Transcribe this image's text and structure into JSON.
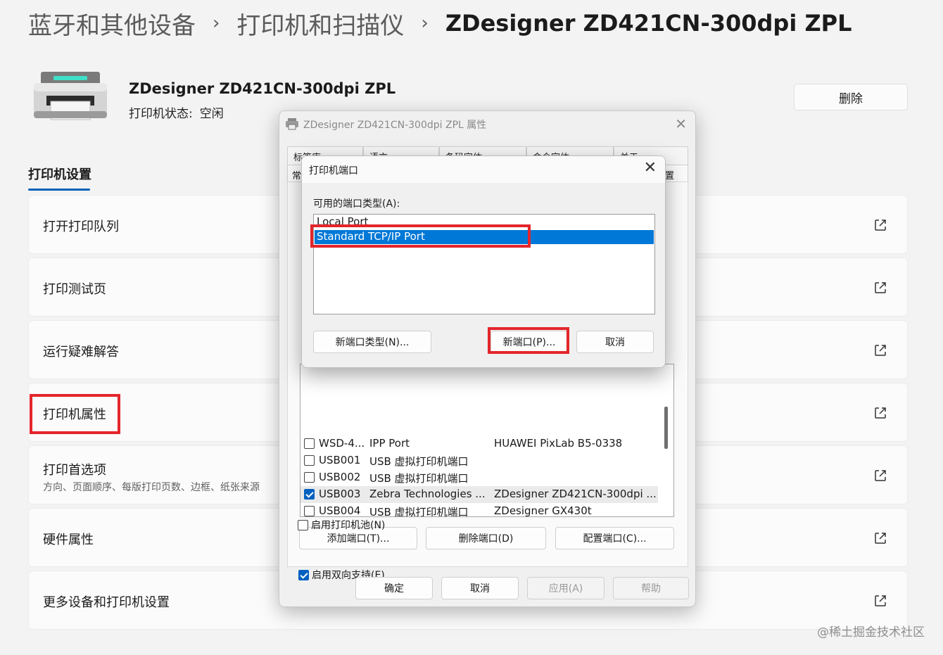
{
  "breadcrumb": {
    "item1": "蓝牙和其他设备",
    "item2": "打印机和扫描仪",
    "current": "ZDesigner ZD421CN-300dpi ZPL",
    "sep": "›"
  },
  "header": {
    "printer_name": "ZDesigner ZD421CN-300dpi ZPL",
    "status_label": "打印机状态:",
    "status_value": "空闲",
    "delete_label": "删除"
  },
  "section_tab": "打印机设置",
  "cards": [
    {
      "label": "打开打印队列"
    },
    {
      "label": "打印测试页"
    },
    {
      "label": "运行疑难解答"
    },
    {
      "label": "打印机属性"
    },
    {
      "label": "打印首选项",
      "sub": "方向、页面顺序、每版打印页数、边框、纸张来源"
    },
    {
      "label": "硬件属性"
    },
    {
      "label": "更多设备和打印机设置"
    }
  ],
  "props_dialog": {
    "title": "ZDesigner ZD421CN-300dpi ZPL 属性",
    "tabs_row1": [
      "标签库",
      "语言",
      "条码字体",
      "命令字体",
      "关于"
    ],
    "tabs_row2": [
      "常",
      "置"
    ],
    "ports": [
      {
        "port": "WSD-4...",
        "desc": "IPP Port",
        "printer": "HUAWEI PixLab B5-0338",
        "checked": false
      },
      {
        "port": "USB001",
        "desc": "USB 虚拟打印机端口",
        "printer": "",
        "checked": false
      },
      {
        "port": "USB002",
        "desc": "USB 虚拟打印机端口",
        "printer": "",
        "checked": false
      },
      {
        "port": "USB003",
        "desc": "Zebra Technologies ...",
        "printer": "ZDesigner ZD421CN-300dpi ...",
        "checked": true
      },
      {
        "port": "USB004",
        "desc": "USB 虚拟打印机端口",
        "printer": "ZDesigner GX430t",
        "checked": false
      }
    ],
    "add_port": "添加端口(T)...",
    "delete_port": "删除端口(D)",
    "config_port": "配置端口(C)...",
    "bidi": "启用双向支持(E)",
    "pool": "启用打印机池(N)",
    "ok": "确定",
    "cancel": "取消",
    "apply": "应用(A)",
    "help": "帮助"
  },
  "port_dialog": {
    "title": "打印机端口",
    "close": "✕",
    "available_label": "可用的端口类型(A):",
    "types": [
      "Local Port",
      "Standard TCP/IP Port"
    ],
    "new_type": "新端口类型(N)...",
    "new_port": "新端口(P)...",
    "cancel": "取消"
  },
  "watermark": "@稀土掘金技术社区",
  "colors": {
    "accent": "#005fb8",
    "highlight_red": "#e3262b",
    "selection": "#0078d7"
  }
}
